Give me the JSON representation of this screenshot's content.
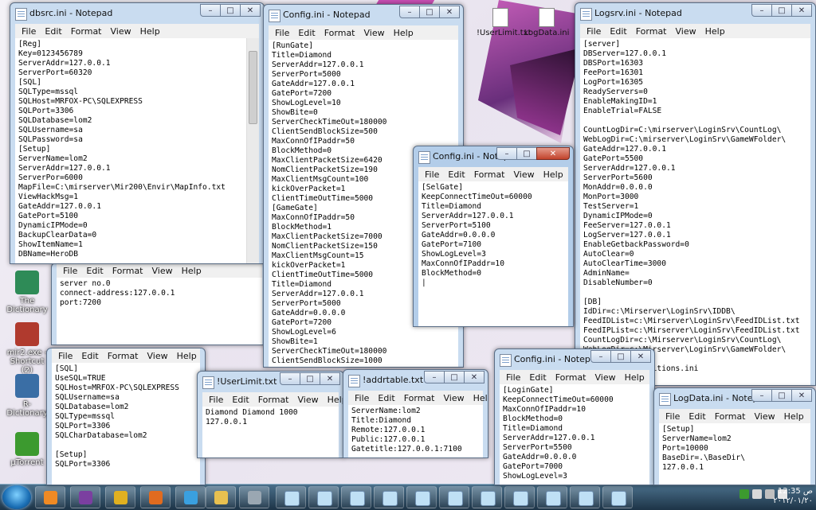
{
  "menu": [
    "File",
    "Edit",
    "Format",
    "View",
    "Help"
  ],
  "controls": {
    "minimize": "–",
    "maximize": "□",
    "close": "✕"
  },
  "desktop_icons": [
    {
      "name": "dictionary-book-icon",
      "label": "The Dictionary",
      "color": "#2e8b57"
    },
    {
      "name": "mir2-shortcut-icon",
      "label": "mir2.exe - Shortcut (2)",
      "color": "#b03a2e"
    },
    {
      "name": "dictionary-shortcut-icon",
      "label": "R- Dictionary",
      "color": "#3a6ea5"
    },
    {
      "name": "utorrent-icon",
      "label": "µTorrent",
      "color": "#3c9a2f"
    }
  ],
  "desktop_files": [
    "!UserLimit.txt",
    "LogData.ini"
  ],
  "windows": {
    "dbsrc": {
      "title": "dbsrc.ini - Notepad",
      "lines": [
        "[Reg]",
        "Key=0123456789",
        "ServerAddr=127.0.0.1",
        "ServerPort=60320",
        "[SQL]",
        "SQLType=mssql",
        "SQLHost=MRFOX-PC\\SQLEXPRESS",
        "SQLPort=3306",
        "SQLDatabase=lom2",
        "SQLUsername=sa",
        "SQLPassword=sa",
        "[Setup]",
        "ServerName=lom2",
        "ServerAddr=127.0.0.1",
        "ServerPor=6000",
        "MapFile=C:\\mirserver\\Mir200\\Envir\\MapInfo.txt",
        "ViewHackMsg=1",
        "GateAddr=127.0.0.1",
        "GatePort=5100",
        "DynamicIPMode=0",
        "BackupClearData=0",
        "ShowItemName=1",
        "DBName=HeroDB"
      ]
    },
    "server": {
      "title": "",
      "lines": [
        "server no.0",
        "connect-address:127.0.0.1",
        "port:7200"
      ]
    },
    "sql": {
      "title": "",
      "lines": [
        "[SQL]",
        "UseSQL=TRUE",
        "SQLHost=MRFOX-PC\\SQLEXPRESS",
        "SQLUsername=sa",
        "SQLDatabase=lom2",
        "SQLType=mssql",
        "SQLPort=3306",
        "SQLCharDatabase=lom2",
        "",
        "[Setup]",
        "SQLPort=3306"
      ]
    },
    "config1": {
      "title": "Config.ini - Notepad",
      "lines": [
        "[RunGate]",
        "Title=Diamond",
        "ServerAddr=127.0.0.1",
        "ServerPort=5000",
        "GateAddr=127.0.0.1",
        "GatePort=7200",
        "ShowLogLevel=10",
        "ShowBite=0",
        "ServerCheckTimeOut=180000",
        "ClientSendBlockSize=500",
        "MaxConnOfIPaddr=50",
        "BlockMethod=0",
        "MaxClientPacketSize=6420",
        "NomClientPacketSize=190",
        "MaxClientMsgCount=100",
        "kickOverPacket=1",
        "ClientTimeOutTime=5000",
        "[GameGate]",
        "MaxConnOfIPaddr=50",
        "BlockMethod=1",
        "MaxClientPacketSize=7000",
        "NomClientPacketSize=150",
        "MaxClientMsgCount=15",
        "kickOverPacket=1",
        "ClientTimeOutTime=5000",
        "Title=Diamond",
        "ServerAddr=127.0.0.1",
        "ServerPort=5000",
        "GateAddr=0.0.0.0",
        "GatePort=7200",
        "ShowLogLevel=6",
        "ShowBite=1",
        "ServerCheckTimeOut=180000",
        "ClientSendBlockSize=1000"
      ]
    },
    "config2": {
      "title": "Config.ini - Notep...",
      "lines": [
        "[SelGate]",
        "KeepConnectTimeOut=60000",
        "Title=Diamond",
        "ServerAddr=127.0.0.1",
        "ServerPort=5100",
        "GateAddr=0.0.0.0",
        "GatePort=7100",
        "ShowLogLevel=3",
        "MaxConnOfIPaddr=10",
        "BlockMethod=0",
        "|"
      ]
    },
    "logsrv": {
      "title": "Logsrv.ini - Notepad",
      "lines": [
        "[server]",
        "DBServer=127.0.0.1",
        "DBSPort=16303",
        "FeePort=16301",
        "LogPort=16305",
        "ReadyServers=0",
        "EnableMakingID=1",
        "EnableTrial=FALSE",
        "",
        "CountLogDir=C:\\mirserver\\LoginSrv\\CountLog\\",
        "WebLogDir=C:\\mirserver\\LoginSrv\\GameWFolder\\",
        "GateAddr=127.0.0.1",
        "GatePort=5500",
        "ServerAddr=127.0.0.1",
        "ServerPort=5600",
        "MonAddr=0.0.0.0",
        "MonPort=3000",
        "TestServer=1",
        "DynamicIPMode=0",
        "FeeServer=127.0.0.1",
        "LogServer=127.0.0.1",
        "EnableGetbackPassword=0",
        "AutoClear=0",
        "AutoClearTime=3000",
        "AdminName=",
        "DisableNumber=0",
        "",
        "[DB]",
        "IdDir=c:\\Mirserver\\LoginSrv\\IDDB\\",
        "FeedIDList=c:\\Mirserver\\LoginSrv\\FeedIDList.txt",
        "FeedIPList=c:\\Mirserver\\LoginSrv\\FeedIDList.txt",
        "CountLogDir=c:\\Mirserver\\LoginSrv\\CountLog\\",
        "WebLogDir=c:\\Mirserver\\LoginSrv\\GameWFolder\\",
        "[Setup]",
        "Positions=.\\Positions.ini"
      ]
    },
    "userlimit": {
      "title": "!UserLimit.txt - ...",
      "lines": [
        "Diamond Diamond 1000",
        "127.0.0.1"
      ]
    },
    "addrtable": {
      "title": "!addrtable.txt - ...",
      "lines": [
        "ServerName:lom2",
        "Title:Diamond",
        "Remote:127.0.0.1",
        "Public:127.0.0.1",
        "Gatetitle:127.0.0.1:7100"
      ]
    },
    "config3": {
      "title": "Config.ini - Notep",
      "lines": [
        "[LoginGate]",
        "KeepConnectTimeOut=60000",
        "MaxConnOfIPaddr=10",
        "BlockMethod=0",
        "Title=Diamond",
        "ServerAddr=127.0.0.1",
        "ServerPort=5500",
        "GateAddr=0.0.0.0",
        "GatePort=7000",
        "ShowLogLevel=3"
      ]
    },
    "logdata": {
      "title": "LogData.ini - Notepad",
      "lines": [
        "[Setup]",
        "ServerName=lom2",
        "Port=10000",
        "BaseDir=.\\BaseDir\\",
        "127.0.0.1"
      ]
    }
  },
  "taskbar": {
    "pinned": [
      {
        "name": "media-player-icon",
        "color": "#f08a24"
      },
      {
        "name": "winrar-icon",
        "color": "#7b3fa0"
      },
      {
        "name": "chrome-icon",
        "color": "#e0b020"
      },
      {
        "name": "firefox-icon",
        "color": "#e06b1f"
      },
      {
        "name": "messenger-icon",
        "color": "#3aa0e0"
      },
      {
        "name": "explorer-folder-icon",
        "color": "#e8c050"
      },
      {
        "name": "tools-icon",
        "color": "#9aa7b2"
      },
      {
        "name": "notepad-icon",
        "color": "#bfe0f5"
      }
    ],
    "clock_time": "12:35 ص",
    "clock_date": "٢٠١٢/٠١/٢٠"
  }
}
